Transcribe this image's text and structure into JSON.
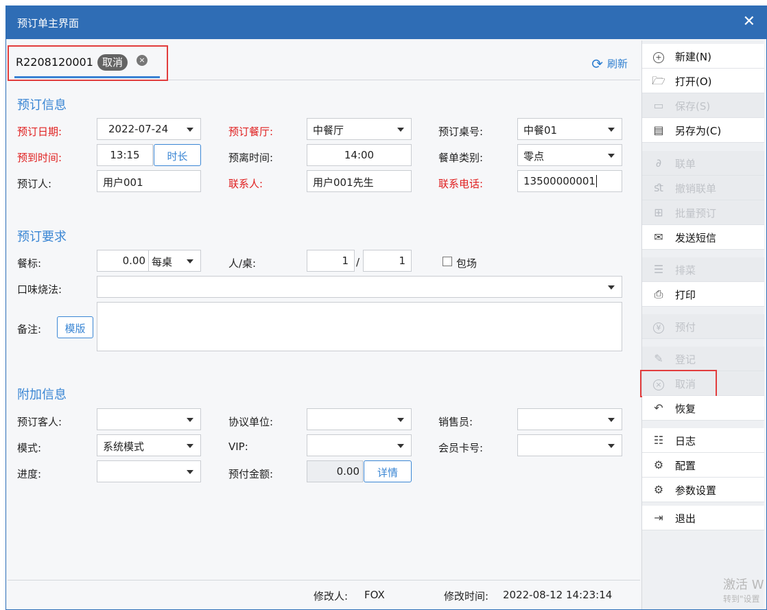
{
  "window": {
    "title": "预订单主界面",
    "close_glyph": "✕"
  },
  "tab": {
    "code": "R2208120001",
    "status": "取消",
    "close_glyph": "×"
  },
  "toolbar": {
    "refresh_label": "刷新",
    "refresh_icon": "refresh-icon"
  },
  "sections": {
    "booking_info": "预订信息",
    "requirements": "预订要求",
    "extra": "附加信息"
  },
  "booking_info": {
    "date_label": "预订日期:",
    "date_value": "2022-07-24",
    "restaurant_label": "预订餐厅:",
    "restaurant_value": "中餐厅",
    "table_label": "预订桌号:",
    "table_value": "中餐01",
    "arrive_label": "预到时间:",
    "arrive_value": "13:15",
    "duration_button": "时长",
    "leave_label": "预离时间:",
    "leave_value": "14:00",
    "menu_type_label": "餐单类别:",
    "menu_type_value": "零点",
    "booker_label": "预订人:",
    "booker_value": "用户001",
    "contact_label": "联系人:",
    "contact_value": "用户001先生",
    "phone_label": "联系电话:",
    "phone_value": "13500000001"
  },
  "requirements": {
    "standard_label": "餐标:",
    "standard_value": "0.00",
    "standard_unit": "每桌",
    "people_label": "人/桌:",
    "people_value": "1",
    "people_sep": "/",
    "table_count": "1",
    "private_label": "包场",
    "flavor_label": "口味烧法:",
    "flavor_value": "",
    "remark_label": "备注:",
    "template_button": "模版",
    "remark_value": ""
  },
  "extra": {
    "guest_label": "预订客人:",
    "guest_value": "",
    "agreement_label": "协议单位:",
    "agreement_value": "",
    "sales_label": "销售员:",
    "sales_value": "",
    "mode_label": "模式:",
    "mode_value": "系统模式",
    "vip_label": "VIP:",
    "vip_value": "",
    "card_label": "会员卡号:",
    "card_value": "",
    "progress_label": "进度:",
    "progress_value": "",
    "prepay_label": "预付金额:",
    "prepay_value": "0.00",
    "detail_button": "详情"
  },
  "footer": {
    "modifier_label": "修改人:",
    "modifier_value": "FOX",
    "time_label": "修改时间:",
    "time_value": "2022-08-12 14:23:14"
  },
  "sidebar": [
    {
      "label": "新建(N)",
      "icon": "plus-circle-icon",
      "glyph": "+",
      "disabled": false
    },
    {
      "label": "打开(O)",
      "icon": "folder-open-icon",
      "glyph": "🗁",
      "disabled": false
    },
    {
      "label": "保存(S)",
      "icon": "save-icon",
      "glyph": "▭",
      "disabled": true
    },
    {
      "label": "另存为(C)",
      "icon": "save-as-icon",
      "glyph": "▤",
      "disabled": false
    },
    {
      "label": "联单",
      "icon": "link-icon",
      "glyph": "∂",
      "disabled": true
    },
    {
      "label": "撤销联单",
      "icon": "unlink-icon",
      "glyph": "ﬆ",
      "disabled": true
    },
    {
      "label": "批量预订",
      "icon": "batch-icon",
      "glyph": "⊞",
      "disabled": true
    },
    {
      "label": "发送短信",
      "icon": "mail-icon",
      "glyph": "✉",
      "disabled": false
    },
    {
      "label": "排菜",
      "icon": "dish-icon",
      "glyph": "☰",
      "disabled": true
    },
    {
      "label": "打印",
      "icon": "print-icon",
      "glyph": "⎙",
      "disabled": false
    },
    {
      "label": "预付",
      "icon": "yen-icon",
      "glyph": "¥",
      "disabled": true
    },
    {
      "label": "登记",
      "icon": "edit-icon",
      "glyph": "✎",
      "disabled": true
    },
    {
      "label": "取消",
      "icon": "cancel-icon",
      "glyph": "×",
      "disabled": true
    },
    {
      "label": "恢复",
      "icon": "undo-icon",
      "glyph": "↶",
      "disabled": false
    },
    {
      "label": "日志",
      "icon": "log-icon",
      "glyph": "☷",
      "disabled": false
    },
    {
      "label": "配置",
      "icon": "gear-icon",
      "glyph": "⚙",
      "disabled": false
    },
    {
      "label": "参数设置",
      "icon": "settings-icon",
      "glyph": "⚙",
      "disabled": false
    },
    {
      "label": "退出",
      "icon": "exit-icon",
      "glyph": "⇥",
      "disabled": false
    }
  ],
  "watermark": {
    "line1": "激活 W",
    "line2": "转到\"设置"
  }
}
